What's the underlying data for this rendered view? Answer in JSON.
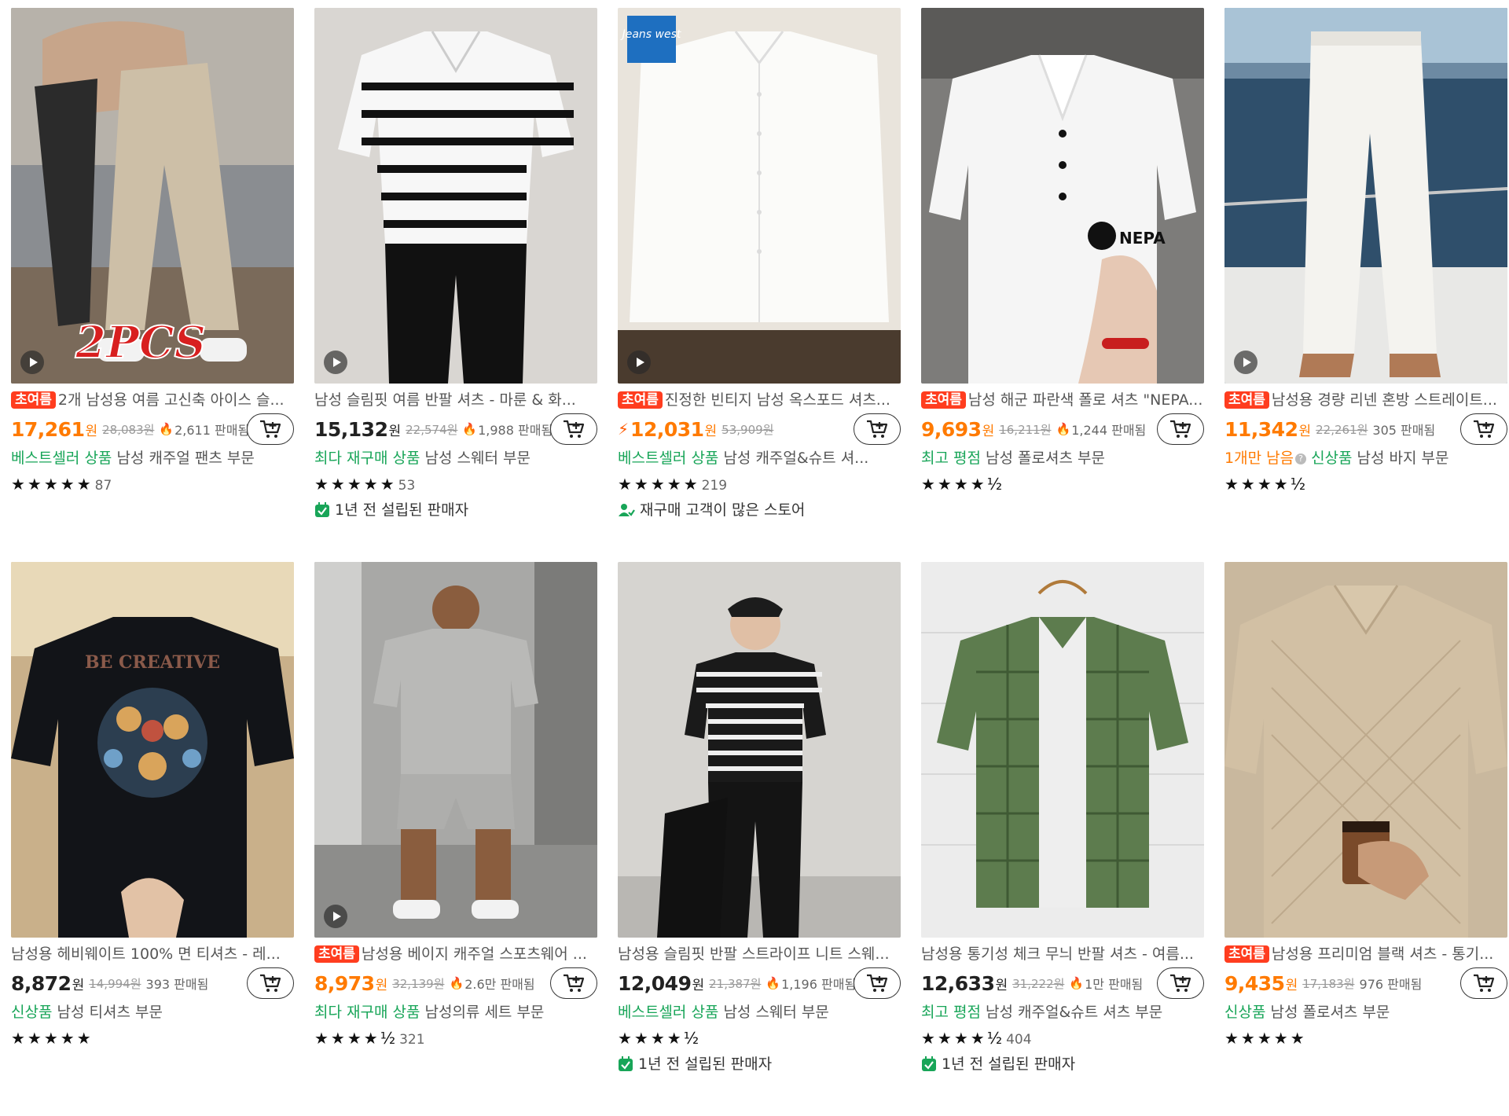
{
  "currency": "원",
  "products": [
    {
      "badge": "초여름",
      "title": "2개 남성용 여름 고신축 아이스 슬...",
      "price": "17,261",
      "original_price": "28,083원",
      "sold": "2,611 판매됨",
      "sold_flame": true,
      "tags": [
        {
          "text": "베스트셀러 상품",
          "color": "green"
        },
        {
          "text": " 남성 캐주얼 팬츠 부문",
          "color": "gray"
        }
      ],
      "stars": "★★★★★",
      "rating_count": "87",
      "seller_info": "",
      "overlay_text": "2PCS",
      "has_video": true,
      "image_icon": "khaki-jogger-pants-image"
    },
    {
      "badge": "",
      "title": "남성 슬림핏 여름 반팔 셔츠 - 마룬 & 화...",
      "price": "15,132",
      "original_price": "22,574원",
      "sold": "1,988 판매됨",
      "sold_flame": true,
      "tags": [
        {
          "text": "최다 재구매 상품",
          "color": "green"
        },
        {
          "text": " 남성 스웨터 부문",
          "color": "gray"
        }
      ],
      "stars": "★★★★★",
      "rating_count": "53",
      "seller_info": "1년 전 설립된 판매자",
      "seller_icon": "calendar-check-icon",
      "has_video": true,
      "image_icon": "striped-polo-image"
    },
    {
      "badge": "초여름",
      "title": "진정한 빈티지 남성 옥스포드 셔츠...",
      "price": "12,031",
      "original_price": "53,909원",
      "sold": "",
      "sold_flame": false,
      "lightning": true,
      "tags": [
        {
          "text": "베스트셀러 상품",
          "color": "green"
        },
        {
          "text": " 남성 캐주얼&슈트 셔...",
          "color": "gray"
        }
      ],
      "stars": "★★★★★",
      "rating_count": "219",
      "seller_info": "재구매 고객이 많은 스토어",
      "seller_icon": "repeat-customer-icon",
      "brand_logo": "Jeans west",
      "has_video": true,
      "image_icon": "white-oxford-shirt-image"
    },
    {
      "badge": "초여름",
      "title": "남성 해군 파란색 폴로 셔츠 \"NEPA...",
      "price": "9,693",
      "original_price": "16,211원",
      "sold": "1,244 판매됨",
      "sold_flame": true,
      "tags": [
        {
          "text": "최고 평점",
          "color": "green"
        },
        {
          "text": " 남성 폴로셔츠 부문",
          "color": "gray"
        }
      ],
      "stars": "★★★★½",
      "rating_count": "",
      "seller_info": "",
      "overlay_text": "NEPA",
      "has_video": false,
      "image_icon": "white-polo-shirt-image"
    },
    {
      "badge": "초여름",
      "title": "남성용 경량 리넨 혼방 스트레이트...",
      "price": "11,342",
      "original_price": "22,261원",
      "sold": "305 판매됨",
      "sold_flame": false,
      "tags": [
        {
          "text": "1개만 남음",
          "color": "orange",
          "info": true
        },
        {
          "text": "신상품",
          "color": "green"
        },
        {
          "text": " 남성 바지 부문",
          "color": "gray"
        }
      ],
      "stars": "★★★★½",
      "rating_count": "",
      "seller_info": "",
      "has_video": true,
      "image_icon": "white-linen-pants-image"
    },
    {
      "badge": "",
      "title": "남성용 헤비웨이트 100% 면 티셔츠 - 레...",
      "price": "8,872",
      "original_price": "14,994원",
      "sold": "393 판매됨",
      "sold_flame": false,
      "tags": [
        {
          "text": "신상품",
          "color": "green"
        },
        {
          "text": " 남성 티셔츠 부문",
          "color": "gray"
        }
      ],
      "stars": "★★★★★",
      "rating_count": "",
      "seller_info": "",
      "overlay_text": "BE CREATIVE",
      "has_video": false,
      "image_icon": "black-graphic-tshirt-image"
    },
    {
      "badge": "초여름",
      "title": "남성용 베이지 캐주얼 스포츠웨어 ...",
      "price": "8,973",
      "original_price": "32,139원",
      "sold": "2.6만 판매됨",
      "sold_flame": true,
      "tags": [
        {
          "text": "최다 재구매 상품",
          "color": "green"
        },
        {
          "text": " 남성의류 세트 부문",
          "color": "gray"
        }
      ],
      "stars": "★★★★½",
      "rating_count": "321",
      "seller_info": "",
      "has_video": true,
      "image_icon": "gray-tracksuit-set-image"
    },
    {
      "badge": "",
      "title": "남성용 슬림핏 반팔 스트라이프 니트 스웨...",
      "price": "12,049",
      "original_price": "21,387원",
      "sold": "1,196 판매됨",
      "sold_flame": true,
      "tags": [
        {
          "text": "베스트셀러 상품",
          "color": "green"
        },
        {
          "text": " 남성 스웨터 부문",
          "color": "gray"
        }
      ],
      "stars": "★★★★½",
      "rating_count": "",
      "seller_info": "1년 전 설립된 판매자",
      "seller_icon": "calendar-check-icon",
      "has_video": false,
      "image_icon": "striped-knit-shirt-image"
    },
    {
      "badge": "",
      "title": "남성용 통기성 체크 무늬 반팔 셔츠 - 여름...",
      "price": "12,633",
      "original_price": "31,222원",
      "sold": "1만 판매됨",
      "sold_flame": true,
      "tags": [
        {
          "text": "최고 평점",
          "color": "green"
        },
        {
          "text": " 남성 캐주얼&슈트 셔츠 부문",
          "color": "gray"
        }
      ],
      "stars": "★★★★½",
      "rating_count": "404",
      "seller_info": "1년 전 설립된 판매자",
      "seller_icon": "calendar-check-icon",
      "has_video": false,
      "image_icon": "green-check-shirt-image"
    },
    {
      "badge": "초여름",
      "title": "남성용 프리미엄 블랙 셔츠 - 통기...",
      "price": "9,435",
      "original_price": "17,183원",
      "sold": "976 판매됨",
      "sold_flame": false,
      "tags": [
        {
          "text": "신상품",
          "color": "green"
        },
        {
          "text": " 남성 폴로셔츠 부문",
          "color": "gray"
        }
      ],
      "stars": "★★★★★",
      "rating_count": "",
      "seller_info": "",
      "has_video": false,
      "image_icon": "beige-textured-polo-image"
    }
  ],
  "colors": {
    "price_orange": "#ff7a00",
    "badge_red": "#ff3d1f",
    "tag_green": "#18a558",
    "text_gray": "#555555"
  }
}
